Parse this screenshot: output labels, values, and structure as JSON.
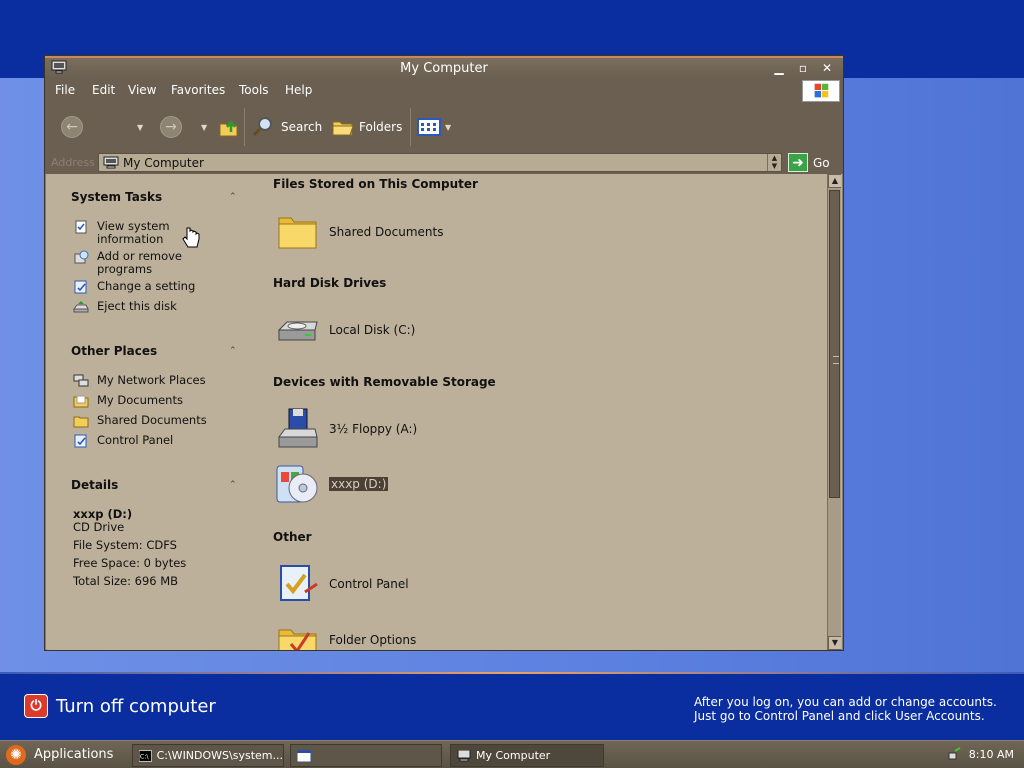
{
  "background": {
    "turn_off_label": "Turn off computer",
    "logon_message_line1": "After you log on, you can add or change accounts.",
    "logon_message_line2": "Just go to Control Panel and click User Accounts."
  },
  "window": {
    "title": "My Computer"
  },
  "menu": [
    "File",
    "Edit",
    "View",
    "Favorites",
    "Tools",
    "Help"
  ],
  "toolbar": {
    "search_label": "Search",
    "folders_label": "Folders"
  },
  "address": {
    "label": "Address",
    "value": "My Computer",
    "go_label": "Go"
  },
  "sidebar": {
    "system_tasks": {
      "heading": "System Tasks",
      "items": [
        {
          "label_line1": "View system",
          "label_line2": "information",
          "icon": "system-info-icon"
        },
        {
          "label_line1": "Add or remove",
          "label_line2": "programs",
          "icon": "add-remove-icon"
        },
        {
          "label_line1": "Change a setting",
          "label_line2": "",
          "icon": "control-panel-icon"
        },
        {
          "label_line1": "Eject this disk",
          "label_line2": "",
          "icon": "eject-icon"
        }
      ]
    },
    "other_places": {
      "heading": "Other Places",
      "items": [
        "My Network Places",
        "My Documents",
        "Shared Documents",
        "Control Panel"
      ]
    },
    "details": {
      "heading": "Details",
      "name": "xxxp (D:)",
      "type": "CD Drive",
      "file_system": "File System: CDFS",
      "free_space": "Free Space: 0 bytes",
      "total_size": "Total Size: 696 MB"
    }
  },
  "main": {
    "groups": [
      {
        "heading": "Files Stored on This Computer",
        "items": [
          "Shared Documents"
        ]
      },
      {
        "heading": "Hard Disk Drives",
        "items": [
          "Local Disk (C:)"
        ]
      },
      {
        "heading": "Devices with Removable Storage",
        "items": [
          "3½ Floppy (A:)",
          "xxxp (D:)"
        ]
      },
      {
        "heading": "Other",
        "items": [
          "Control Panel",
          "Folder Options"
        ]
      }
    ],
    "selected_item": "xxxp (D:)"
  },
  "taskbar": {
    "apps_label": "Applications",
    "items": [
      "C:\\WINDOWS\\system...",
      "",
      "My Computer"
    ],
    "clock": "8:10 AM"
  }
}
